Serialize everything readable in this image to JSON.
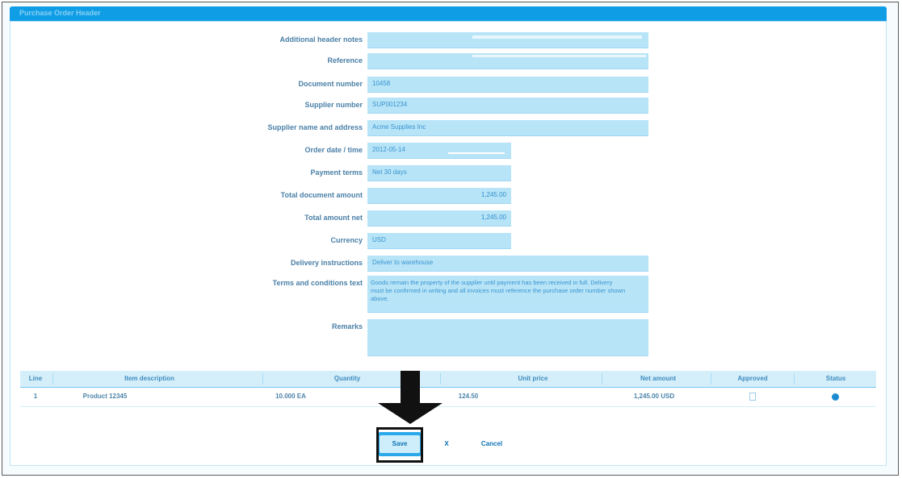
{
  "window": {
    "title": "Purchase Order Header"
  },
  "form": {
    "fields": [
      {
        "label": "Additional header notes",
        "value": ""
      },
      {
        "label": "Reference",
        "value": ""
      },
      {
        "label": "Document number",
        "value": "10458"
      },
      {
        "label": "Supplier number",
        "value": "SUP001234"
      },
      {
        "label": "Supplier name and address",
        "value": "Acme Supplies Inc"
      },
      {
        "label": "Order date / time",
        "value": "2012-05-14"
      },
      {
        "label": "Payment terms",
        "value": "Net 30 days"
      },
      {
        "label": "Total document amount",
        "value": "1,245.00"
      },
      {
        "label": "Total amount net",
        "value": "1,245.00"
      },
      {
        "label": "Currency",
        "value": "USD"
      },
      {
        "label": "Delivery instructions",
        "value": "Deliver to warehouse"
      },
      {
        "label": "Terms and conditions text",
        "value": "Goods remain the property of the supplier until payment has been received in full. Delivery must be confirmed in writing and all invoices must reference the purchase order number shown above."
      },
      {
        "label": "Remarks",
        "value": ""
      }
    ]
  },
  "table": {
    "columns": [
      "Line",
      "Item description",
      "Quantity",
      "Unit price",
      "Net amount",
      "Approved",
      "Status"
    ],
    "rows": [
      {
        "line": "1",
        "description": "Product 12345",
        "quantity": "10.000 EA",
        "unit_price": "124.50",
        "net_amount": "1,245.00 USD",
        "approved": false,
        "status_icon": "status-dot-icon"
      }
    ]
  },
  "actions": {
    "primary_label": "Save",
    "second_label": "X",
    "third_label": "Cancel"
  },
  "annotation": {
    "arrow_icon": "down-arrow-icon",
    "highlight_color": "#111111",
    "accent_color": "#0f9ee6"
  }
}
